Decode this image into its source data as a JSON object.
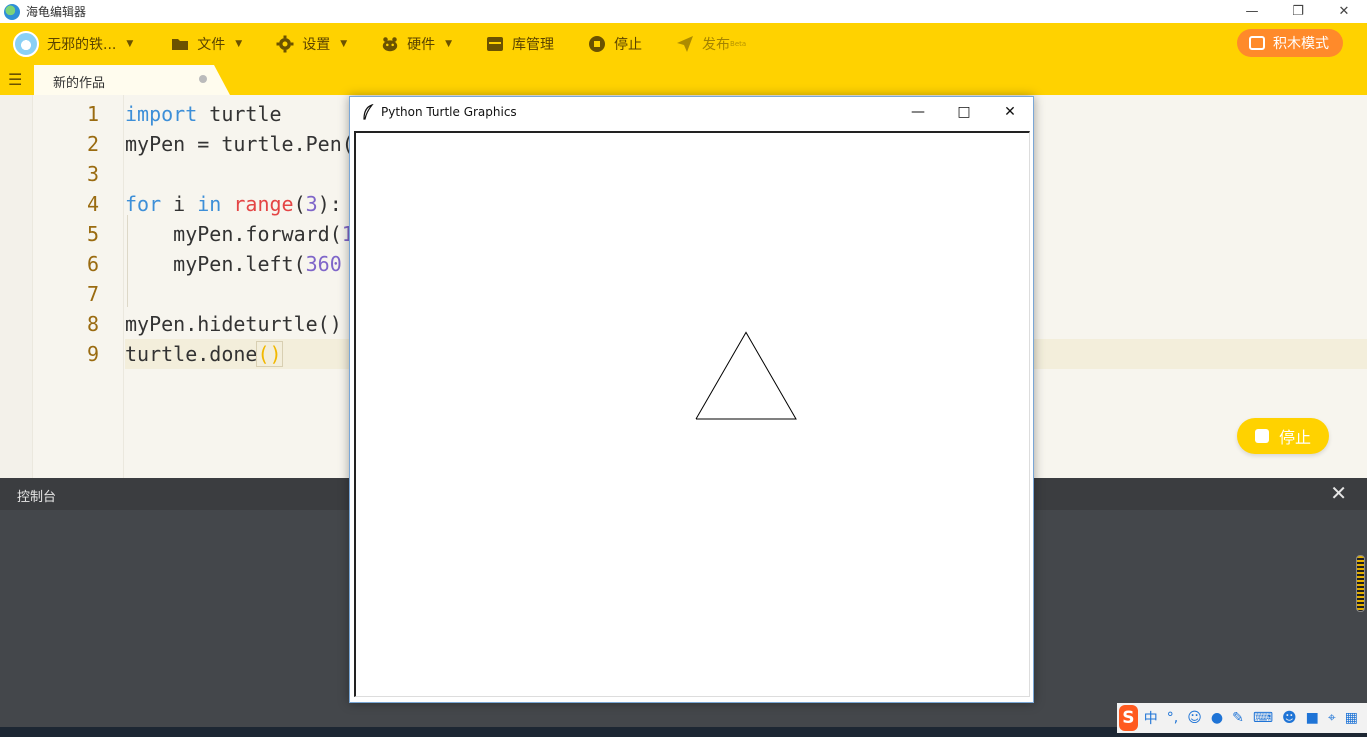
{
  "app": {
    "title": "海龟编辑器",
    "window_controls": [
      "minimize",
      "restore",
      "close"
    ]
  },
  "toolbar": {
    "user_name": "无邪的铁...",
    "items": [
      {
        "label": "文件",
        "icon": "folder-icon",
        "dropdown": true
      },
      {
        "label": "设置",
        "icon": "gear-icon",
        "dropdown": true
      },
      {
        "label": "硬件",
        "icon": "hardware-icon",
        "dropdown": true
      },
      {
        "label": "库管理",
        "icon": "library-icon",
        "dropdown": false
      },
      {
        "label": "停止",
        "icon": "stop-icon",
        "dropdown": false
      },
      {
        "label": "发布",
        "icon": "send-icon",
        "dropdown": false,
        "badge": "Beta"
      }
    ],
    "block_mode_label": "积木模式",
    "accent_color": "#ffd200",
    "block_mode_color": "#ff8a2a"
  },
  "tabs": [
    {
      "label": "新的作品",
      "unsaved": true
    }
  ],
  "editor": {
    "lines": [
      {
        "n": "1"
      },
      {
        "n": "2"
      },
      {
        "n": "3"
      },
      {
        "n": "4"
      },
      {
        "n": "5"
      },
      {
        "n": "6"
      },
      {
        "n": "7"
      },
      {
        "n": "8"
      },
      {
        "n": "9"
      }
    ],
    "code": {
      "l1_kw": "import",
      "l1_rest": " turtle",
      "l2": "myPen = turtle.Pen(",
      "l4_kw1": "for",
      "l4_mid": " i ",
      "l4_kw2": "in",
      "l4_sp": " ",
      "l4_bi": "range",
      "l4_p1": "(",
      "l4_num": "3",
      "l4_p2": "):",
      "l5_pre": "    myPen.forward(",
      "l5_num": "1",
      "l6_pre": "    myPen.left(",
      "l6_num": "360",
      "l8": "myPen.hideturtle()",
      "l9_pre": "turtle.done",
      "l9_paren": "()"
    },
    "active_line": 9
  },
  "float_button": {
    "label": "停止"
  },
  "console": {
    "title": "控制台"
  },
  "turtle_window": {
    "title": "Python Turtle Graphics",
    "triangle": {
      "side": 100,
      "turns_deg": 120,
      "start": [
        0,
        0
      ]
    }
  },
  "ime": {
    "mode": "中",
    "punct": "°,"
  }
}
